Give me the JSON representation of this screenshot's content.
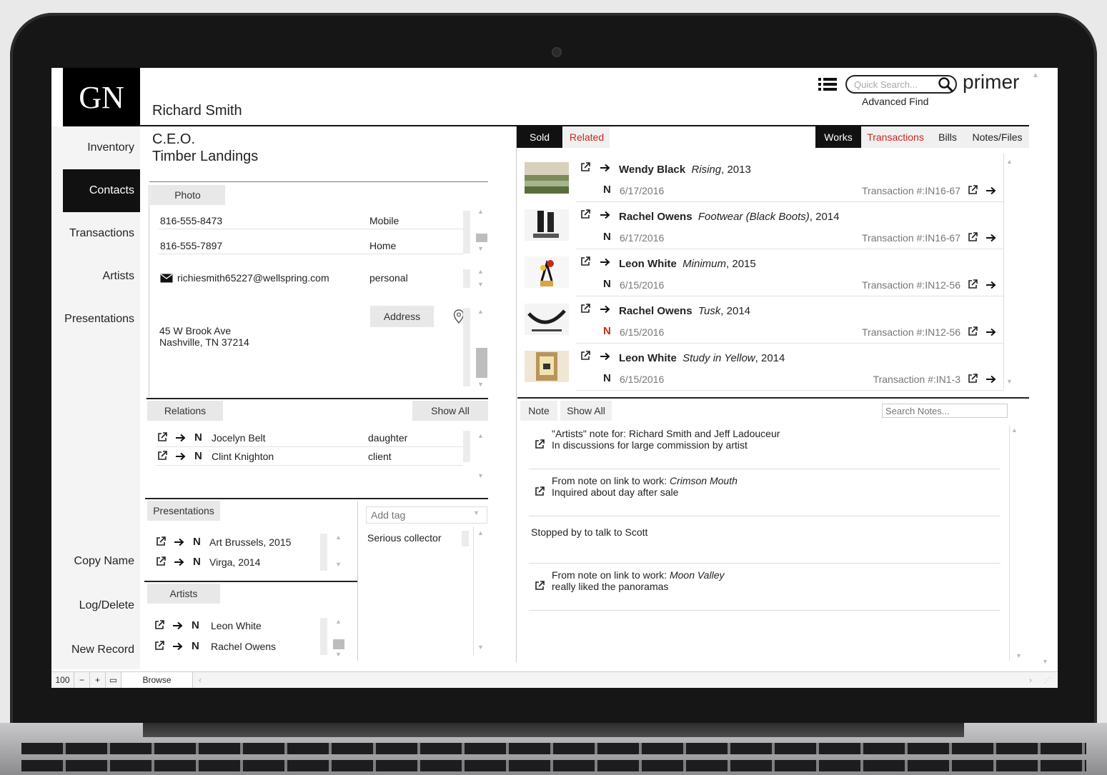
{
  "app": {
    "logo": "GN",
    "brand": "primer",
    "search_placeholder": "Quick Search...",
    "advanced_find": "Advanced Find",
    "colors": {
      "accent_red": "#c8281e",
      "dark": "#111111"
    }
  },
  "sidebar": {
    "items": [
      {
        "label": "Inventory",
        "active": false
      },
      {
        "label": "Contacts",
        "active": true
      },
      {
        "label": "Transactions",
        "active": false
      },
      {
        "label": "Artists",
        "active": false
      },
      {
        "label": "Presentations",
        "active": false
      }
    ],
    "actions": [
      {
        "label": "Copy Name"
      },
      {
        "label": "Log/Delete"
      },
      {
        "label": "New Record"
      }
    ]
  },
  "contact": {
    "name": "Richard Smith",
    "title": "C.E.O.",
    "company": "Timber Landings",
    "photo_label": "Photo",
    "phones": [
      {
        "number": "816-555-8473",
        "type": "Mobile"
      },
      {
        "number": "816-555-7897",
        "type": "Home"
      }
    ],
    "email": {
      "address": "richiesmith65227@wellspring.com",
      "type": "personal"
    },
    "address_label": "Address",
    "address_line1": "45 W Brook Ave",
    "address_line2": "Nashville, TN 37214"
  },
  "relations": {
    "label": "Relations",
    "show_all": "Show All",
    "items": [
      {
        "flag": "N",
        "name": "Jocelyn Belt",
        "role": "daughter"
      },
      {
        "flag": "N",
        "name": "Clint Knighton",
        "role": "client"
      }
    ]
  },
  "presentations": {
    "label": "Presentations",
    "items": [
      {
        "flag": "N",
        "name": "Art Brussels, 2015"
      },
      {
        "flag": "N",
        "name": "Virga, 2014"
      }
    ]
  },
  "tags": {
    "placeholder": "Add tag",
    "items": [
      "Serious collector"
    ]
  },
  "artists": {
    "label": "Artists",
    "items": [
      {
        "flag": "N",
        "name": "Leon White"
      },
      {
        "flag": "N",
        "name": "Rachel Owens"
      }
    ]
  },
  "right_tabs": {
    "left": [
      {
        "label": "Sold"
      },
      {
        "label": "Related"
      }
    ],
    "right": [
      {
        "label": "Works"
      },
      {
        "label": "Transactions"
      },
      {
        "label": "Bills"
      },
      {
        "label": "Notes/Files"
      }
    ]
  },
  "works": [
    {
      "artist": "Wendy Black",
      "title": "Rising",
      "year": ", 2013",
      "flag": "N",
      "flag_red": false,
      "date": "6/17/2016",
      "transaction": "Transaction #:IN16-67",
      "thumb": "landscape"
    },
    {
      "artist": "Rachel Owens",
      "title": "Footwear (Black Boots)",
      "year": ", 2014",
      "flag": "N",
      "flag_red": false,
      "date": "6/17/2016",
      "transaction": "Transaction #:IN16-67",
      "thumb": "boots"
    },
    {
      "artist": "Leon White",
      "title": "Minimum",
      "year": ", 2015",
      "flag": "N",
      "flag_red": false,
      "date": "6/15/2016",
      "transaction": "Transaction #:IN12-56",
      "thumb": "sculpture"
    },
    {
      "artist": "Rachel Owens",
      "title": "Tusk",
      "year": ", 2014",
      "flag": "N",
      "flag_red": true,
      "date": "6/15/2016",
      "transaction": "Transaction #:IN12-56",
      "thumb": "tusk"
    },
    {
      "artist": "Leon White",
      "title": "Study in Yellow",
      "year": ", 2014",
      "flag": "N",
      "flag_red": false,
      "date": "6/15/2016",
      "transaction": "Transaction #:IN1-3",
      "thumb": "yellow"
    }
  ],
  "notes": {
    "label": "Note",
    "show_all": "Show All",
    "search_placeholder": "Search Notes...",
    "items": [
      {
        "line1": "\"Artists\" note for: Richard Smith and Jeff Ladouceur",
        "line1_em": "",
        "line2": "In discussions for large commission by artist",
        "linked": true
      },
      {
        "line1": "From note on link to work: ",
        "line1_em": "Crimson Mouth",
        "line2": "Inquired about day after sale",
        "linked": true
      },
      {
        "line1": "Stopped by to talk to Scott",
        "line1_em": "",
        "line2": "",
        "linked": false
      },
      {
        "line1": "From note on link to work: ",
        "line1_em": "Moon Valley",
        "line2": "really liked the panoramas",
        "linked": true
      }
    ]
  },
  "status_bar": {
    "zoom": "100",
    "mode": "Browse"
  }
}
